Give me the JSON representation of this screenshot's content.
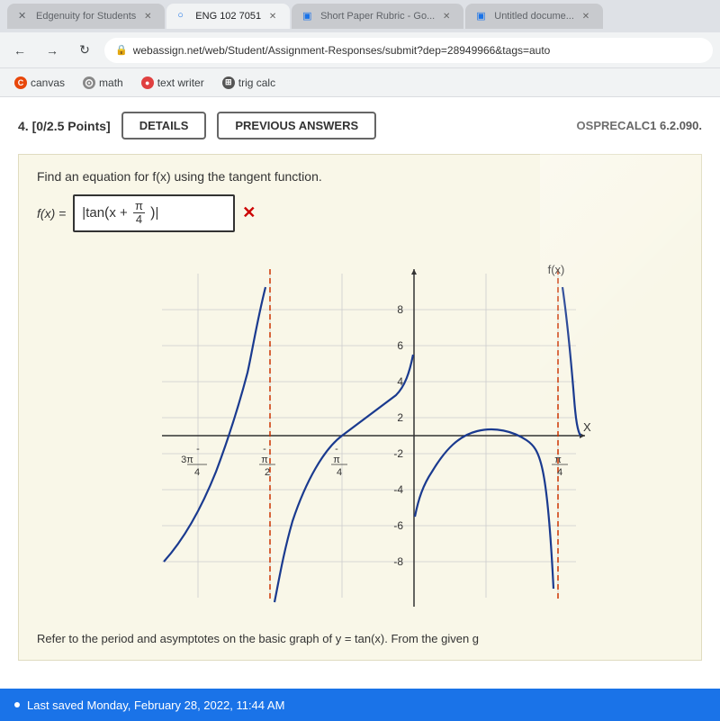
{
  "browser": {
    "tabs": [
      {
        "label": "Edgenuity for Students",
        "active": false,
        "icon": "✕"
      },
      {
        "label": "ENG 102 7051",
        "active": true,
        "icon": "○"
      },
      {
        "label": "Short Paper Rubric - Go...",
        "active": false,
        "icon": "□"
      },
      {
        "label": "Untitled docume...",
        "active": false,
        "icon": "□"
      }
    ],
    "url": "webassign.net/web/Student/Assignment-Responses/submit?dep=28949966&tags=auto",
    "bookmarks": [
      {
        "label": "canvas",
        "icon": "C",
        "color": "#e8470a"
      },
      {
        "label": "math",
        "icon": "⊙",
        "color": "#888"
      },
      {
        "label": "text writer",
        "icon": "●",
        "color": "#e04040"
      },
      {
        "label": "trig calc",
        "icon": "⊞",
        "color": "#555"
      }
    ]
  },
  "question": {
    "number": "4.",
    "points": "[0/2.5 Points]",
    "details_btn": "DETAILS",
    "prev_answers_btn": "PREVIOUS ANSWERS",
    "problem_id": "OSPRECALC1 6.2.090.",
    "instruction": "Find an equation for f(x) using the tangent function.",
    "answer_label": "f(x) =",
    "answer_value": "|tan(x + π/4)|",
    "answer_display": "tan(x + π/4)",
    "answer_formula_pre": "|",
    "answer_formula_mid": "tan",
    "answer_formula_x": "x + ",
    "answer_formula_pi": "π",
    "answer_formula_denom": "4",
    "answer_formula_post": "|",
    "refer_text": "Refer to the period and asymptotes on the basic graph of  y = tan(x).  From the given g"
  },
  "graph": {
    "label_fx": "f(x)",
    "label_x": "X",
    "y_axis_values": [
      "8",
      "6",
      "4",
      "2",
      "-2",
      "-4",
      "-6",
      "-8"
    ],
    "x_axis_labels": [
      "-3π/4",
      "-π/2",
      "-π/4",
      "",
      "π/4"
    ],
    "asymptote_color": "#cc3300",
    "curve_color": "#1a3a8f"
  },
  "bottom_bar": {
    "text": "Last saved Monday, February 28, 2022, 11:44 AM"
  }
}
